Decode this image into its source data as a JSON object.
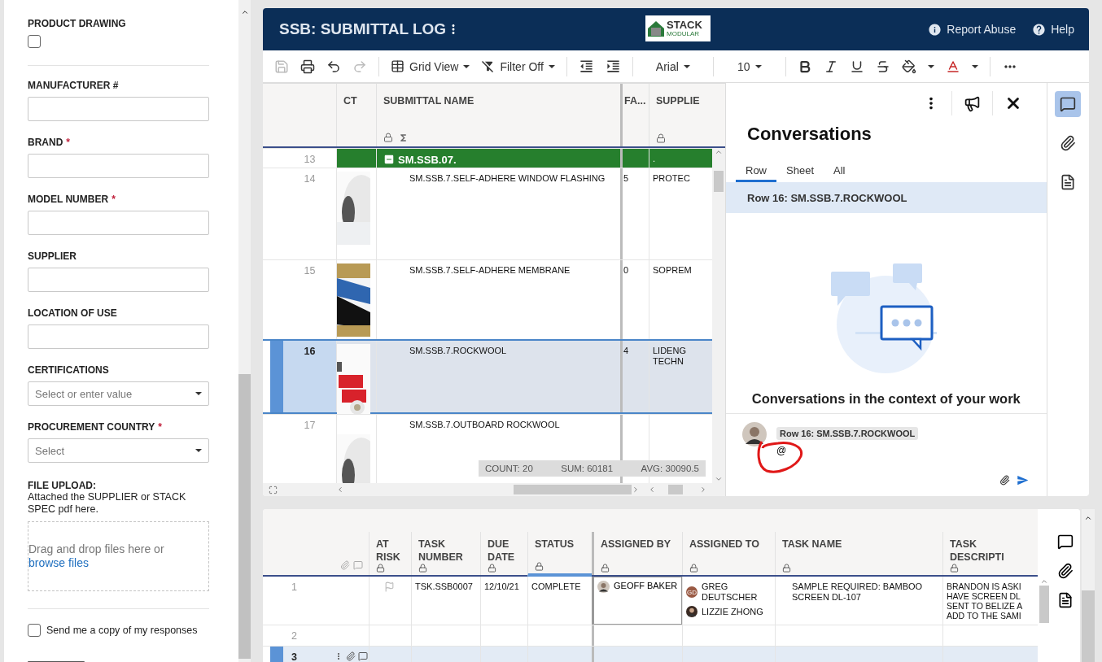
{
  "form": {
    "fields": [
      {
        "kind": "checkbox",
        "label": "PRODUCT DRAWING",
        "checked": false
      },
      {
        "kind": "text",
        "label": "MANUFACTURER #"
      },
      {
        "kind": "text",
        "label": "BRAND",
        "required_mark": "*"
      },
      {
        "kind": "text",
        "label": "MODEL NUMBER",
        "required_mark": "*"
      },
      {
        "kind": "text",
        "label": "SUPPLIER"
      },
      {
        "kind": "text",
        "label": "LOCATION OF USE"
      },
      {
        "kind": "select",
        "label": "CERTIFICATIONS",
        "placeholder": "Select or enter value"
      },
      {
        "kind": "select",
        "label": "PROCUREMENT COUNTRY",
        "required_mark": "*",
        "placeholder": "Select"
      },
      {
        "kind": "upload",
        "label": "FILE UPLOAD:",
        "help": "Attached the SUPPLIER or STACK SPEC pdf here.",
        "drop_text": "Drag and drop files here or",
        "link": "browse files"
      },
      {
        "kind": "option",
        "label": "Send me a copy of my responses",
        "checked": false
      }
    ]
  },
  "sheet": {
    "title": "SSB: SUBMITTAL LOG",
    "logo": {
      "name": "STACK",
      "tagline": "MODULAR"
    },
    "header_links": [
      "Report Abuse",
      "Help"
    ],
    "toolbar": {
      "save_disabled": true,
      "redo_disabled": true,
      "view": "Grid View",
      "filter": "Filter Off",
      "font": "Arial",
      "size": "10"
    },
    "columns": [
      "CT",
      "SUBMITTAL NAME",
      "FA...",
      "SUPPLIE"
    ],
    "rows": [
      {
        "kind": "group",
        "number": "13",
        "name": "SM.SSB.07.",
        "fa": "",
        "supplier": ".",
        "expanded": true,
        "selected": false
      },
      {
        "kind": "item",
        "number": "14",
        "name": "SM.SSB.7.SELF-ADHERE WINDOW FLASHING",
        "fa": "5",
        "supplier": "PROTEC",
        "selected": false
      },
      {
        "kind": "item",
        "number": "15",
        "name": "SM.SSB.7.SELF-ADHERE MEMBRANE",
        "fa": "0",
        "supplier": "SOPREM",
        "selected": false
      },
      {
        "kind": "item",
        "number": "16",
        "name": "SM.SSB.7.ROCKWOOL",
        "fa": "4",
        "supplier": "LIDENG TECHN",
        "selected": true
      },
      {
        "kind": "item",
        "number": "17",
        "name": "SM.SSB.7.OUTBOARD ROCKWOOL",
        "fa": "",
        "supplier": "",
        "selected": false
      }
    ],
    "summary": [
      {
        "label": "COUNT:",
        "value": "20"
      },
      {
        "label": "SUM:",
        "value": "60181"
      },
      {
        "label": "AVG:",
        "value": "30090.5"
      }
    ]
  },
  "conversations": {
    "title": "Conversations",
    "tabs": [
      {
        "label": "Row",
        "selected": true
      },
      {
        "label": "Sheet",
        "selected": false
      },
      {
        "label": "All",
        "selected": false
      }
    ],
    "context": "Row 16: SM.SSB.7.ROCKWOOL",
    "empty_title": "Conversations in the context of your work",
    "composer": {
      "chip": "Row 16: SM.SSB.7.ROCKWOOL",
      "value": "@"
    }
  },
  "rail": [
    {
      "selected": true
    },
    {
      "selected": false
    },
    {
      "selected": false
    }
  ],
  "tasks": {
    "columns": [
      "AT RISK",
      "TASK NUMBER",
      "DUE DATE",
      "STATUS",
      "ASSIGNED BY",
      "ASSIGNED TO",
      "TASK NAME",
      "TASK DESCRIPTI"
    ],
    "rows": [
      {
        "number": "1",
        "selected": false,
        "at_risk": false,
        "task_number": "TSK.SSB0007",
        "due": "12/10/21",
        "status": "COMPLETE",
        "assigned_by": "GEOFF BAKER",
        "assigned_to": [
          {
            "initials": "GD",
            "name": "GREG DEUTSCHER"
          },
          {
            "name": "LIZZIE ZHONG"
          }
        ],
        "task_name": "SAMPLE REQUIRED: BAMBOO SCREEN DL-107",
        "description": "BRANDON IS ASKI HAVE SCREEN DL SENT TO BELIZE A ADD TO THE SAMI"
      },
      {
        "number": "2",
        "selected": false
      },
      {
        "number": "3",
        "selected": true
      }
    ]
  }
}
